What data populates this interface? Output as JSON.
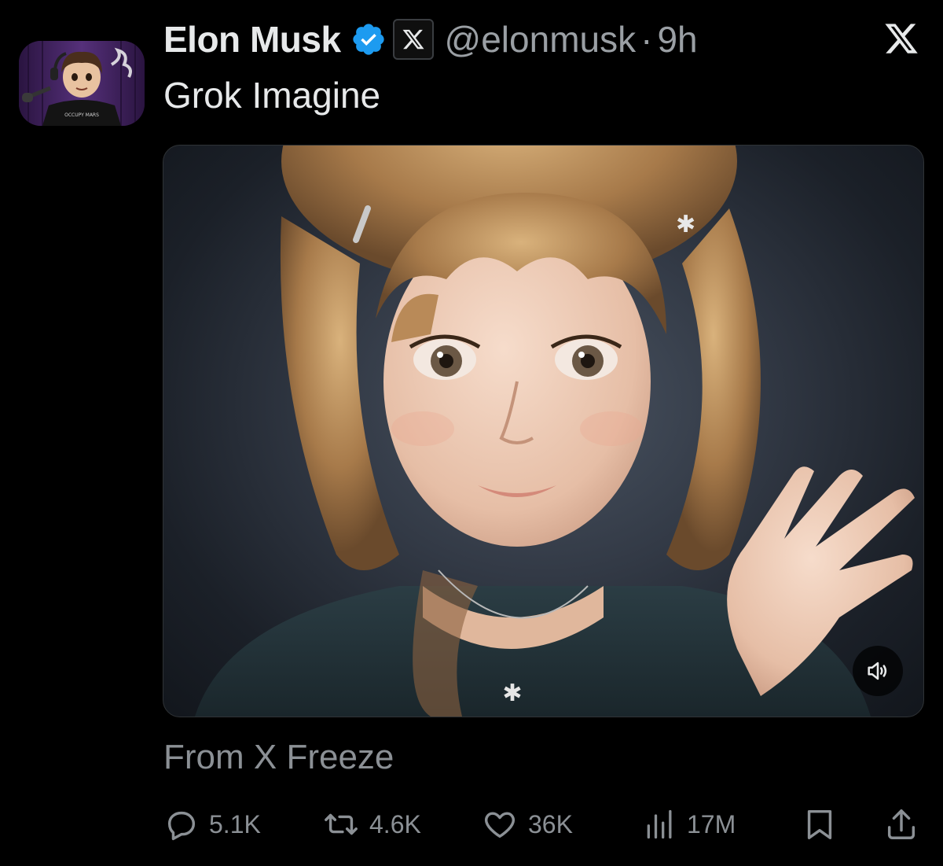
{
  "tweet": {
    "author_name": "Elon Musk",
    "handle": "@elonmusk",
    "separator": "·",
    "time": "9h",
    "text": "Grok Imagine",
    "attribution": "From X Freeze"
  },
  "avatar": {
    "shirt_text": "OCCUPY MARS"
  },
  "icons": {
    "verified": "verified-badge-icon",
    "affiliation": "x-affiliation-icon",
    "platform": "x-logo-icon",
    "sound": "speaker-icon",
    "reply": "reply-icon",
    "repost": "repost-icon",
    "like": "like-icon",
    "views": "views-icon",
    "bookmark": "bookmark-icon",
    "share": "share-icon"
  },
  "actions": {
    "replies": "5.1K",
    "reposts": "4.6K",
    "likes": "36K",
    "views": "17M"
  },
  "colors": {
    "background": "#000000",
    "text": "#e7e9ea",
    "muted": "#8b9095",
    "verified_blue": "#1d9bf0"
  }
}
